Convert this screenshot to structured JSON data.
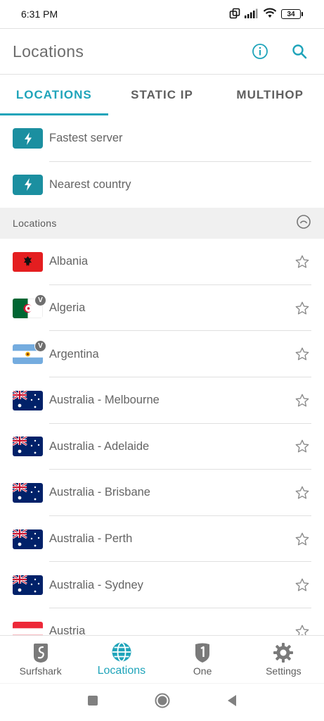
{
  "status_bar": {
    "time": "6:31 PM",
    "battery": "34"
  },
  "app_bar": {
    "title": "Locations"
  },
  "tabs": [
    {
      "label": "LOCATIONS",
      "active": true
    },
    {
      "label": "STATIC IP",
      "active": false
    },
    {
      "label": "MULTIHOP",
      "active": false
    }
  ],
  "quick_connect": [
    {
      "label": "Fastest server",
      "icon": "lightning-icon"
    },
    {
      "label": "Nearest country",
      "icon": "lightning-icon"
    }
  ],
  "section": {
    "title": "Locations"
  },
  "locations": [
    {
      "label": "Albania",
      "flag": "albania",
      "virtual": false
    },
    {
      "label": "Algeria",
      "flag": "algeria",
      "virtual": true
    },
    {
      "label": "Argentina",
      "flag": "argentina",
      "virtual": true
    },
    {
      "label": "Australia - Melbourne",
      "flag": "australia",
      "virtual": false
    },
    {
      "label": "Australia - Adelaide",
      "flag": "australia",
      "virtual": false
    },
    {
      "label": "Australia - Brisbane",
      "flag": "australia",
      "virtual": false
    },
    {
      "label": "Australia - Perth",
      "flag": "australia",
      "virtual": false
    },
    {
      "label": "Australia - Sydney",
      "flag": "australia",
      "virtual": false
    },
    {
      "label": "Austria",
      "flag": "austria",
      "virtual": false
    }
  ],
  "virtual_badge": "V",
  "bottom_nav": [
    {
      "label": "Surfshark",
      "icon": "surfshark-logo-icon",
      "active": false
    },
    {
      "label": "Locations",
      "icon": "globe-icon",
      "active": true
    },
    {
      "label": "One",
      "icon": "shield-one-icon",
      "active": false
    },
    {
      "label": "Settings",
      "icon": "gear-icon",
      "active": false
    }
  ],
  "colors": {
    "accent": "#1fa4ba",
    "quick_icon_bg": "#1b8fa0"
  }
}
